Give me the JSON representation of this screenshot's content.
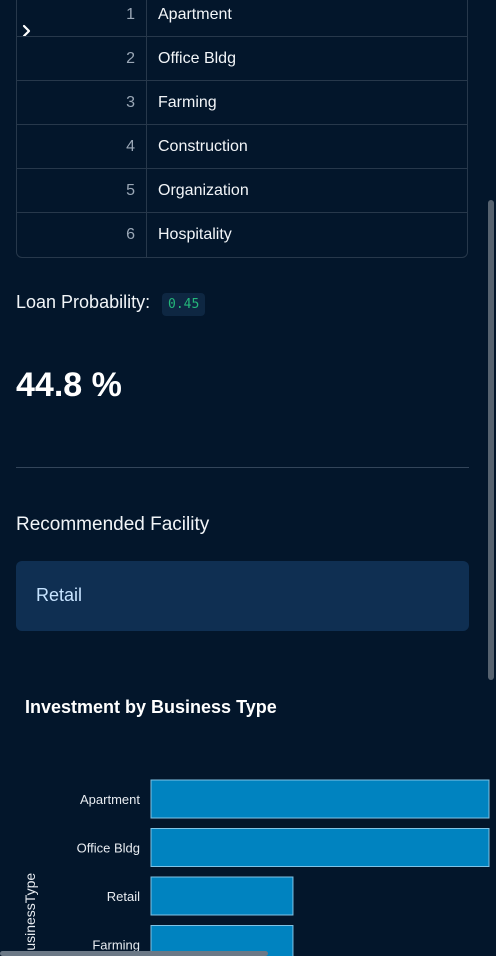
{
  "sidebar": {
    "toggle_icon": "chevron-right-icon"
  },
  "table": {
    "rows": [
      {
        "index": "1",
        "value": "Apartment"
      },
      {
        "index": "2",
        "value": "Office Bldg"
      },
      {
        "index": "3",
        "value": "Farming"
      },
      {
        "index": "4",
        "value": "Construction"
      },
      {
        "index": "5",
        "value": "Organization"
      },
      {
        "index": "6",
        "value": "Hospitality"
      }
    ]
  },
  "loan": {
    "label": "Loan Probability:",
    "code_value": "0.45",
    "percent": "44.8 %"
  },
  "recommendation": {
    "heading": "Recommended Facility",
    "value": "Retail"
  },
  "colors": {
    "background": "#03162b",
    "bar": "#0083c0",
    "info_box": "#0f2f52",
    "code_text": "#24b67a"
  },
  "chart_data": {
    "type": "bar",
    "orientation": "horizontal",
    "title": "Investment by Business Type",
    "ylabel": "BusinessType",
    "categories": [
      "Apartment",
      "Office Bldg",
      "Retail",
      "Farming"
    ],
    "values": [
      100,
      100,
      42,
      42
    ]
  }
}
